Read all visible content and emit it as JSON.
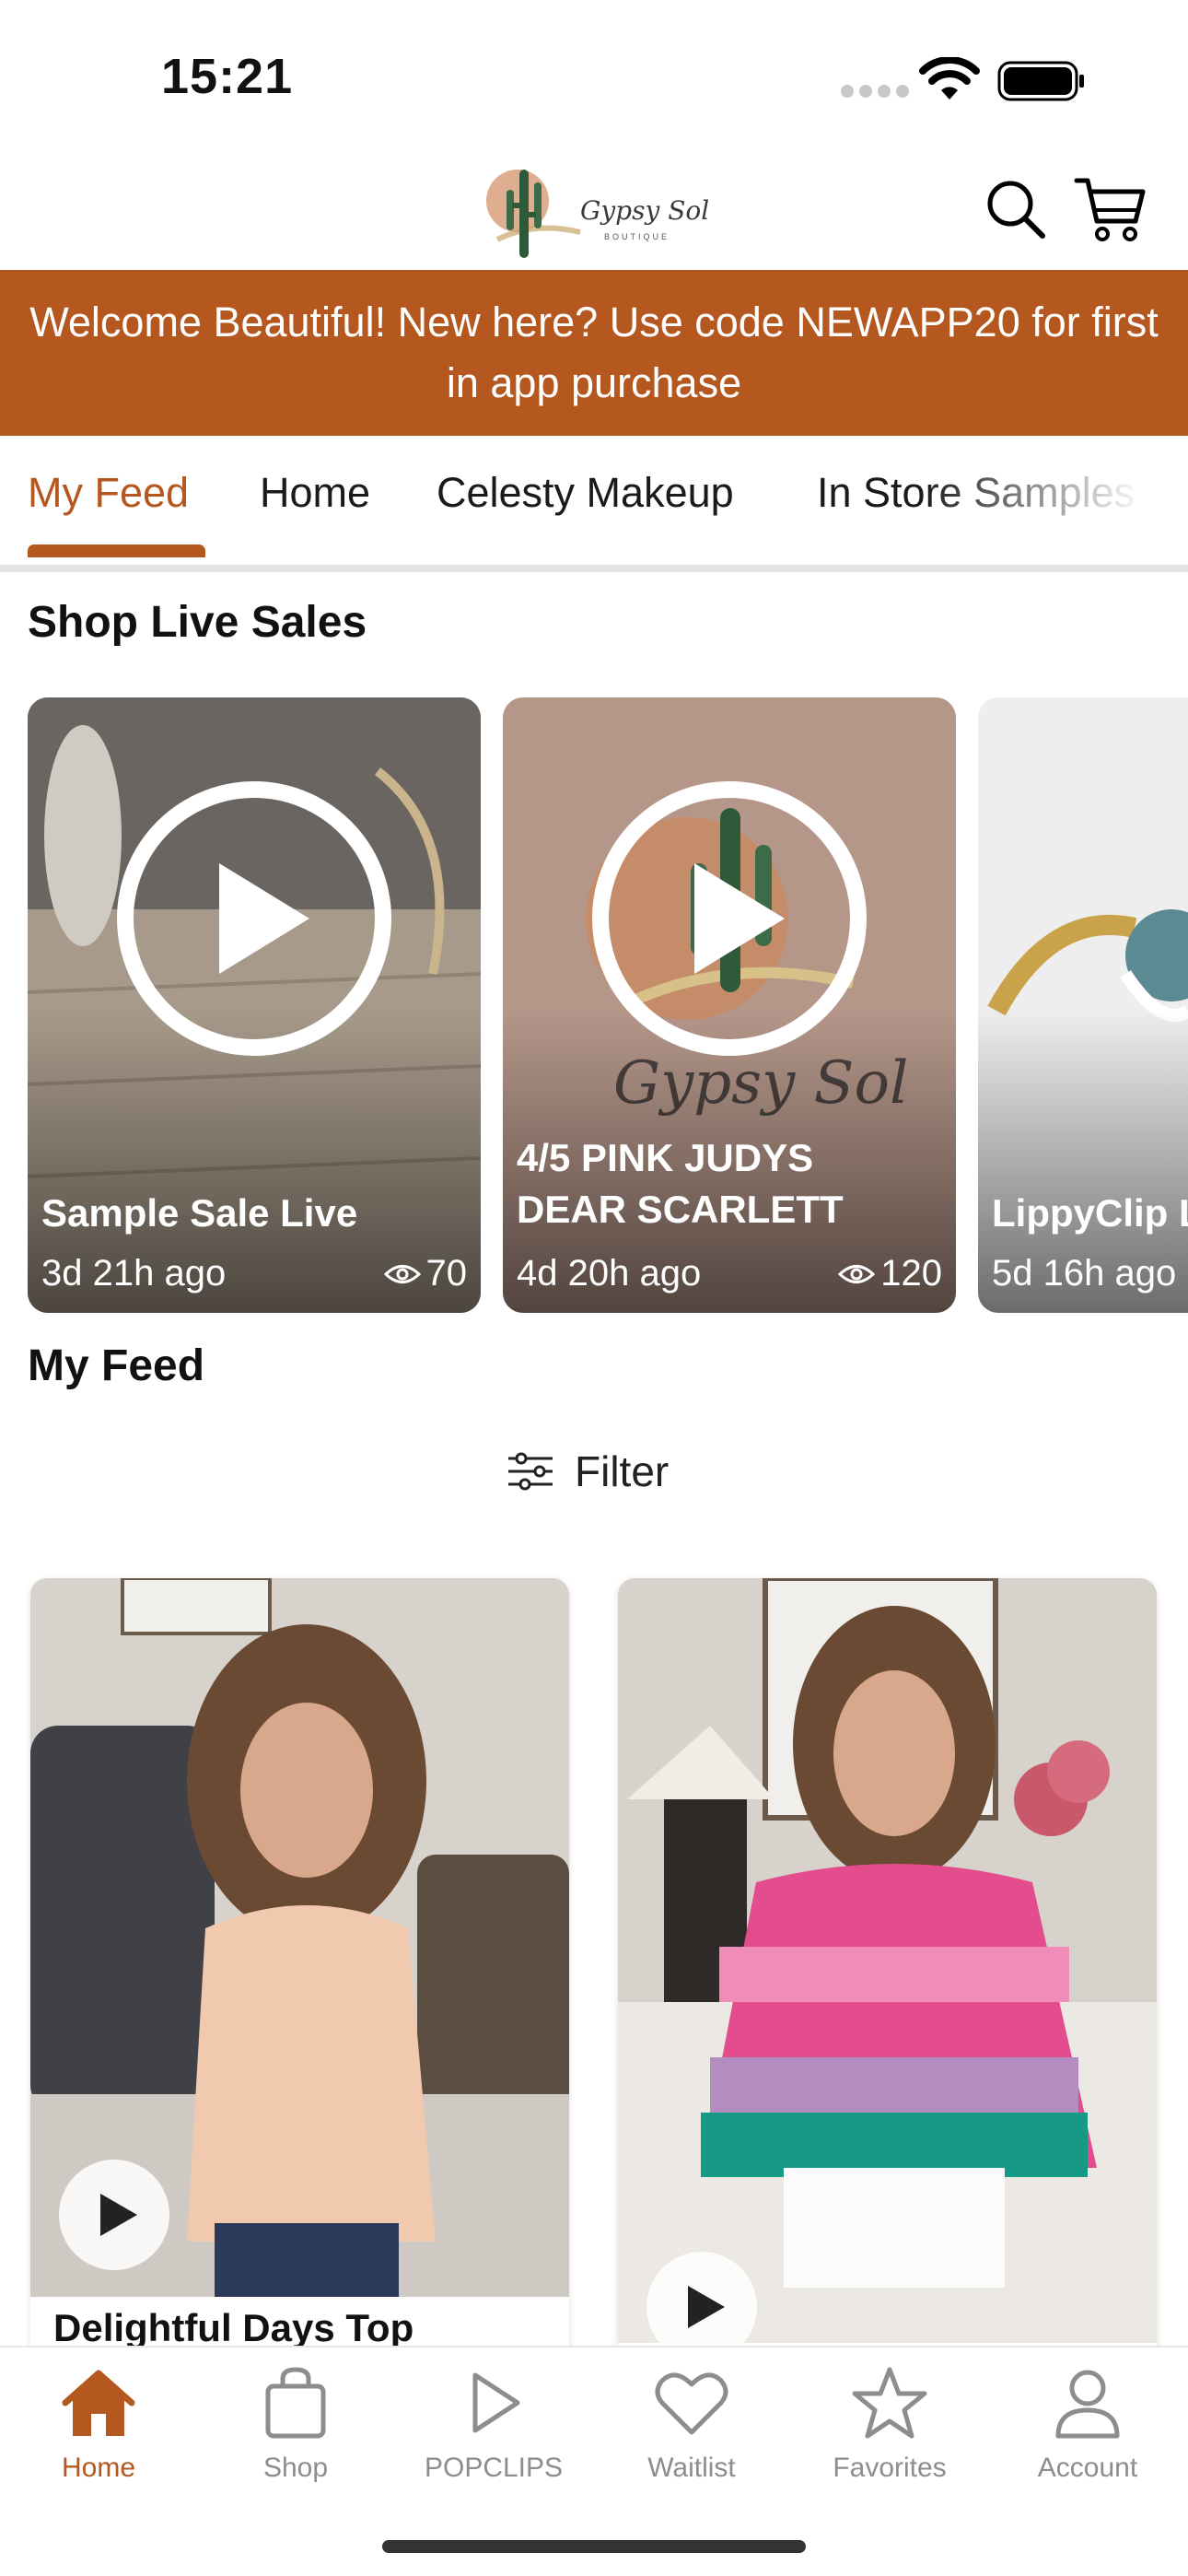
{
  "status_bar": {
    "time": "15:21"
  },
  "header": {
    "logo_name": "Gypsy Sol",
    "logo_sub": "BOUTIQUE"
  },
  "promo": {
    "text": "Welcome Beautiful! New here? Use code NEWAPP20 for first in app purchase"
  },
  "tabs": [
    {
      "label": "My Feed",
      "active": true
    },
    {
      "label": "Home",
      "active": false
    },
    {
      "label": "Celesty Makeup",
      "active": false
    },
    {
      "label": "In Store Samples",
      "active": false
    }
  ],
  "live_section": {
    "title": "Shop Live Sales",
    "cards": [
      {
        "title": "Sample Sale Live",
        "time": "3d 21h ago",
        "views": "70"
      },
      {
        "title": "4/5 PINK JUDYS DEAR SCARLETT",
        "title_line1": "4/5 PINK JUDYS",
        "title_line2": "DEAR SCARLETT",
        "time": "4d 20h ago",
        "views": "120"
      },
      {
        "title": "LippyClip L",
        "time": "5d 16h ago",
        "views": ""
      }
    ]
  },
  "feed": {
    "title": "My Feed",
    "filter_label": "Filter",
    "products": [
      {
        "name": "Delightful Days Top"
      },
      {
        "name": ""
      }
    ]
  },
  "bottom_nav": [
    {
      "label": "Home",
      "icon": "home-icon",
      "active": true
    },
    {
      "label": "Shop",
      "icon": "shopping-bag-icon",
      "active": false
    },
    {
      "label": "POPCLIPS",
      "icon": "play-icon",
      "active": false
    },
    {
      "label": "Waitlist",
      "icon": "heart-icon",
      "active": false
    },
    {
      "label": "Favorites",
      "icon": "star-icon",
      "active": false
    },
    {
      "label": "Account",
      "icon": "user-icon",
      "active": false
    }
  ],
  "colors": {
    "accent": "#b4581f",
    "nav_inactive": "#8d8d8d"
  }
}
